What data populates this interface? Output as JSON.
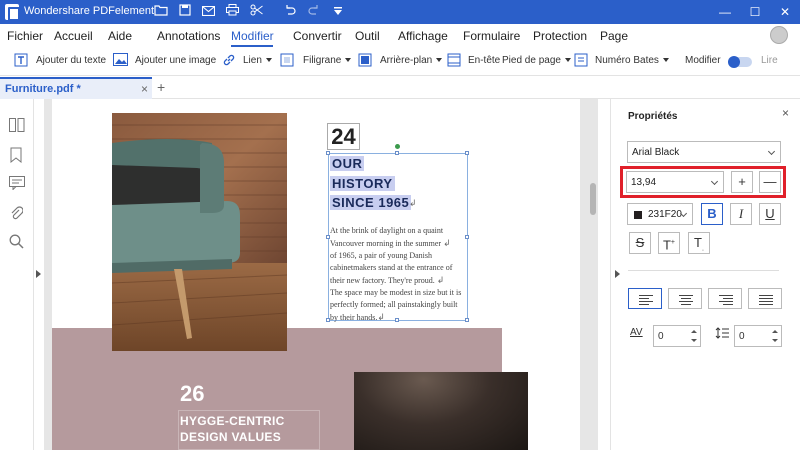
{
  "app": {
    "title": "Wondershare PDFelement"
  },
  "title_icons": [
    "folder-icon",
    "save-icon",
    "mail-icon",
    "print-icon",
    "cut-icon",
    "undo-icon",
    "redo-icon",
    "dropdown-icon"
  ],
  "window": {
    "minimize": "—",
    "maximize": "☐",
    "close": "✕"
  },
  "menu": {
    "items": [
      "Fichier",
      "Accueil",
      "Aide",
      "Annotations",
      "Modifier",
      "Convertir",
      "Outil",
      "Affichage",
      "Formulaire",
      "Protection",
      "Page"
    ],
    "active": "Modifier"
  },
  "toolbar": {
    "add_text": "Ajouter du texte",
    "add_image": "Ajouter une image",
    "link": "Lien",
    "watermark": "Filigrane",
    "background": "Arrière-plan",
    "header": "En-tête",
    "footer": "Pied de page",
    "bates": "Numéro Bates",
    "modify": "Modifier",
    "read": "Lire"
  },
  "tabs": {
    "doc_name": "Furniture.pdf *",
    "close": "×",
    "add": "+"
  },
  "document": {
    "number_top": "24",
    "headline": [
      "OUR",
      "HISTORY",
      "SINCE 1965"
    ],
    "para1": [
      "At the brink of daylight on a quaint",
      "Vancouver morning in the summer",
      "of 1965, a pair of young Danish",
      "cabinetmakers stand at the entrance of",
      "their new factory. They're proud."
    ],
    "para2": [
      "The space may be modest in size but it is",
      "perfectly formed; all painstakingly built",
      "by their hands."
    ],
    "return_mark": "↲",
    "number_bottom": "26",
    "bottom_headline": [
      "HYGGE-CENTRIC",
      "DESIGN VALUES"
    ]
  },
  "properties": {
    "title": "Propriétés",
    "close": "×",
    "font_family": "Arial Black",
    "font_size": "13,94",
    "increase": "+",
    "decrease": "—",
    "color_hex": "231F20",
    "color_value": "#231f20",
    "bold": "B",
    "italic": "I",
    "underline": "U",
    "strike": "S",
    "superscript": "T",
    "subscript": "T",
    "char_spacing_label": "AV",
    "char_spacing": "0",
    "line_spacing": "0",
    "alignment_active": "left"
  },
  "colors": {
    "accent": "#2b5fc9",
    "highlight": "#e0202a",
    "band": "#b59a9d"
  }
}
